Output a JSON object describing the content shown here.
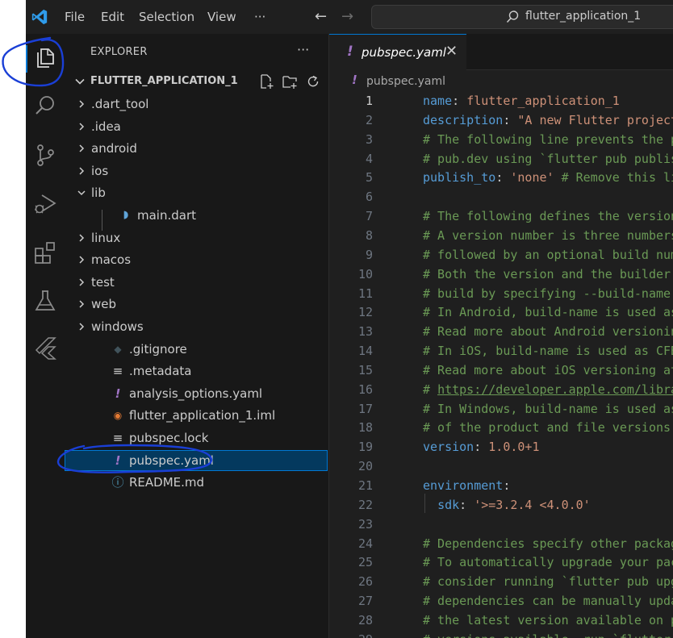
{
  "titlebar": {
    "menu": [
      "File",
      "Edit",
      "Selection",
      "View",
      "···"
    ],
    "back_arrow": "←",
    "forward_arrow": "→",
    "search_text": "flutter_application_1"
  },
  "activity_bar": {
    "items": [
      "explorer-icon",
      "search-icon",
      "source-control-icon",
      "run-debug-icon",
      "extensions-icon",
      "testing-icon",
      "flutter-icon"
    ],
    "active": "explorer-icon"
  },
  "sidebar": {
    "title": "EXPLORER",
    "more": "···",
    "workspace": "FLUTTER_APPLICATION_1",
    "tree": [
      {
        "name": ".dart_tool",
        "kind": "folder"
      },
      {
        "name": ".idea",
        "kind": "folder"
      },
      {
        "name": "android",
        "kind": "folder"
      },
      {
        "name": "ios",
        "kind": "folder"
      },
      {
        "name": "lib",
        "kind": "folder-open"
      },
      {
        "name": "main.dart",
        "kind": "dart"
      },
      {
        "name": "linux",
        "kind": "folder"
      },
      {
        "name": "macos",
        "kind": "folder"
      },
      {
        "name": "test",
        "kind": "folder"
      },
      {
        "name": "web",
        "kind": "folder"
      },
      {
        "name": "windows",
        "kind": "folder"
      },
      {
        "name": ".gitignore",
        "kind": "git"
      },
      {
        "name": ".metadata",
        "kind": "lines"
      },
      {
        "name": "analysis_options.yaml",
        "kind": "yaml"
      },
      {
        "name": "flutter_application_1.iml",
        "kind": "rss"
      },
      {
        "name": "pubspec.lock",
        "kind": "lines"
      },
      {
        "name": "pubspec.yaml",
        "kind": "yaml",
        "selected": true
      },
      {
        "name": "README.md",
        "kind": "info"
      }
    ]
  },
  "editor": {
    "tab": {
      "label": "pubspec.yaml",
      "icon": "!",
      "close": "✕"
    },
    "breadcrumb": {
      "icon": "!",
      "label": "pubspec.yaml"
    },
    "active_line": 1,
    "lines": [
      {
        "n": "1",
        "t": [
          [
            "k",
            "name"
          ],
          [
            "p",
            ": "
          ],
          [
            "s",
            "flutter_application_1"
          ]
        ]
      },
      {
        "n": "2",
        "t": [
          [
            "k",
            "description"
          ],
          [
            "p",
            ": "
          ],
          [
            "s",
            "\"A new Flutter project."
          ]
        ]
      },
      {
        "n": "3",
        "t": [
          [
            "c",
            "# The following line prevents the pa"
          ]
        ]
      },
      {
        "n": "4",
        "t": [
          [
            "c",
            "# pub.dev using `flutter pub publish"
          ]
        ]
      },
      {
        "n": "5",
        "t": [
          [
            "k",
            "publish_to"
          ],
          [
            "p",
            ": "
          ],
          [
            "s",
            "'none'"
          ],
          [
            "p",
            " "
          ],
          [
            "c",
            "# Remove this lin"
          ]
        ]
      },
      {
        "n": "6",
        "t": []
      },
      {
        "n": "7",
        "t": [
          [
            "c",
            "# The following defines the version "
          ]
        ]
      },
      {
        "n": "8",
        "t": [
          [
            "c",
            "# A version number is three numbers "
          ]
        ]
      },
      {
        "n": "9",
        "t": [
          [
            "c",
            "# followed by an optional build numb"
          ]
        ]
      },
      {
        "n": "10",
        "t": [
          [
            "c",
            "# Both the version and the builder n"
          ]
        ]
      },
      {
        "n": "11",
        "t": [
          [
            "c",
            "# build by specifying --build-name a"
          ]
        ]
      },
      {
        "n": "12",
        "t": [
          [
            "c",
            "# In Android, build-name is used as "
          ]
        ]
      },
      {
        "n": "13",
        "t": [
          [
            "c",
            "# Read more about Android versioning"
          ]
        ]
      },
      {
        "n": "14",
        "t": [
          [
            "c",
            "# In iOS, build-name is used as CFBu"
          ]
        ]
      },
      {
        "n": "15",
        "t": [
          [
            "c",
            "# Read more about iOS versioning at "
          ]
        ]
      },
      {
        "n": "16",
        "t": [
          [
            "c",
            "# "
          ],
          [
            "cu",
            "https://developer.apple.com/librar"
          ]
        ]
      },
      {
        "n": "17",
        "t": [
          [
            "c",
            "# In Windows, build-name is used as "
          ]
        ]
      },
      {
        "n": "18",
        "t": [
          [
            "c",
            "# of the product and file versions w"
          ]
        ]
      },
      {
        "n": "19",
        "t": [
          [
            "k",
            "version"
          ],
          [
            "p",
            ": "
          ],
          [
            "s",
            "1.0.0+1"
          ]
        ]
      },
      {
        "n": "20",
        "t": []
      },
      {
        "n": "21",
        "t": [
          [
            "k",
            "environment"
          ],
          [
            "p",
            ":"
          ]
        ]
      },
      {
        "n": "22",
        "t": [
          [
            "p",
            "  "
          ],
          [
            "k",
            "sdk"
          ],
          [
            "p",
            ": "
          ],
          [
            "s",
            "'>=3.2.4 <4.0.0'"
          ]
        ]
      },
      {
        "n": "23",
        "t": []
      },
      {
        "n": "24",
        "t": [
          [
            "c",
            "# Dependencies specify other package"
          ]
        ]
      },
      {
        "n": "25",
        "t": [
          [
            "c",
            "# To automatically upgrade your pack"
          ]
        ]
      },
      {
        "n": "26",
        "t": [
          [
            "c",
            "# consider running `flutter pub upgr"
          ]
        ]
      },
      {
        "n": "27",
        "t": [
          [
            "c",
            "# dependencies can be manually updat"
          ]
        ]
      },
      {
        "n": "28",
        "t": [
          [
            "c",
            "# the latest version available on pu"
          ]
        ]
      },
      {
        "n": "29",
        "t": [
          [
            "c",
            "# versions available, run `flutter p"
          ]
        ]
      }
    ]
  },
  "colors": {
    "accent": "#0078d4",
    "selection": "#04395e",
    "annotation_pen": "#1a3fd6",
    "yaml_icon": "#a074c4"
  }
}
